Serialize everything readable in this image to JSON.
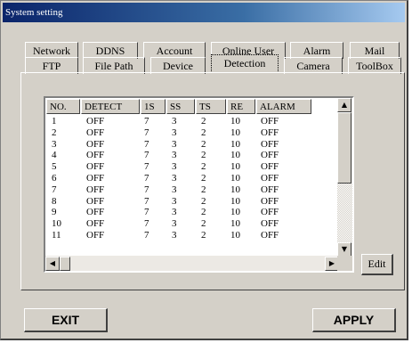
{
  "window": {
    "title": "System setting"
  },
  "tabs_back": [
    "Network",
    "DDNS",
    "Account",
    "Online User",
    "Alarm",
    "Mail"
  ],
  "tabs_front": [
    "FTP",
    "File Path",
    "Device",
    "Detection",
    "Camera",
    "ToolBox"
  ],
  "active_tab": "Detection",
  "table": {
    "columns": [
      "NO.",
      "DETECT",
      "1S",
      "SS",
      "TS",
      "RE",
      "ALARM"
    ],
    "rows": [
      [
        "1",
        "OFF",
        "7",
        "3",
        "2",
        "10",
        "OFF"
      ],
      [
        "2",
        "OFF",
        "7",
        "3",
        "2",
        "10",
        "OFF"
      ],
      [
        "3",
        "OFF",
        "7",
        "3",
        "2",
        "10",
        "OFF"
      ],
      [
        "4",
        "OFF",
        "7",
        "3",
        "2",
        "10",
        "OFF"
      ],
      [
        "5",
        "OFF",
        "7",
        "3",
        "2",
        "10",
        "OFF"
      ],
      [
        "6",
        "OFF",
        "7",
        "3",
        "2",
        "10",
        "OFF"
      ],
      [
        "7",
        "OFF",
        "7",
        "3",
        "2",
        "10",
        "OFF"
      ],
      [
        "8",
        "OFF",
        "7",
        "3",
        "2",
        "10",
        "OFF"
      ],
      [
        "9",
        "OFF",
        "7",
        "3",
        "2",
        "10",
        "OFF"
      ],
      [
        "10",
        "OFF",
        "7",
        "3",
        "2",
        "10",
        "OFF"
      ],
      [
        "11",
        "OFF",
        "7",
        "3",
        "2",
        "10",
        "OFF"
      ]
    ]
  },
  "buttons": {
    "edit": "Edit",
    "exit": "EXIT",
    "apply": "APPLY"
  },
  "icons": {
    "scroll_up": "arrow-up-icon",
    "scroll_down": "arrow-down-icon",
    "scroll_left": "arrow-left-icon",
    "scroll_right": "arrow-right-icon"
  },
  "colors": {
    "face": "#d4d0c8",
    "title_start": "#0a246a",
    "title_end": "#a6caf0"
  }
}
